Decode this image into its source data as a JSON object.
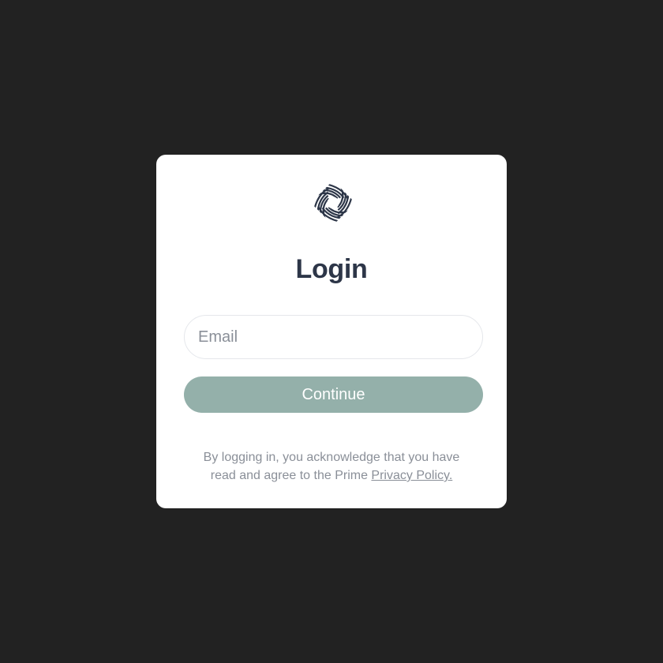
{
  "login_card": {
    "logo_icon": "swirl-diamond-logo-icon",
    "title": "Login",
    "email_input": {
      "value": "",
      "placeholder": "Email"
    },
    "continue_button_label": "Continue",
    "legal": {
      "text_line1": "By logging in, you acknowledge that you have",
      "text_line2": "read and agree to the Prime",
      "privacy_link_label": "Privacy Policy."
    }
  },
  "colors": {
    "page_background": "#222222",
    "card_background": "#ffffff",
    "title": "#2d3648",
    "button": "#94b0aa",
    "muted_text": "#8a8f98"
  }
}
